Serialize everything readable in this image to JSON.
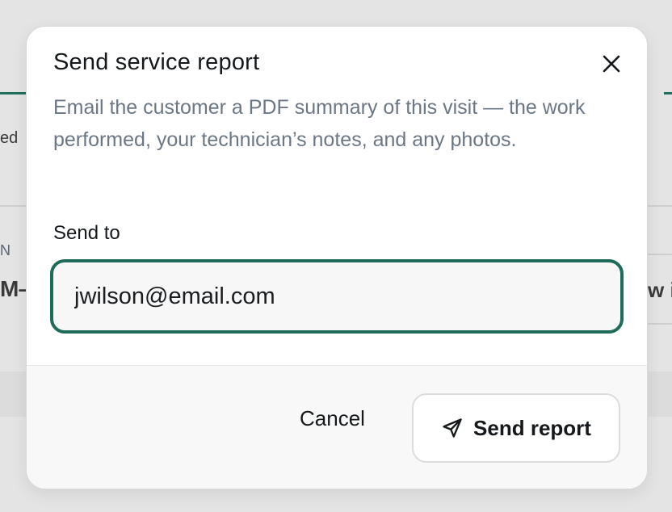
{
  "background": {
    "fragments": [
      "ed",
      "N",
      "M—",
      "w in"
    ]
  },
  "dialog": {
    "title": "Send service report",
    "description": "Email the customer a PDF summary of this visit — the work performed, your technician’s notes, and any photos.",
    "close_icon": "close-icon"
  },
  "form": {
    "send_to_label": "Send to",
    "email_value": "jwilson@email.com"
  },
  "footer": {
    "cancel_label": "Cancel",
    "send_label": "Send report",
    "send_icon": "send-icon"
  },
  "colors": {
    "accent": "#1d6b58",
    "title": "#15191c",
    "muted_text": "#6b7785"
  }
}
